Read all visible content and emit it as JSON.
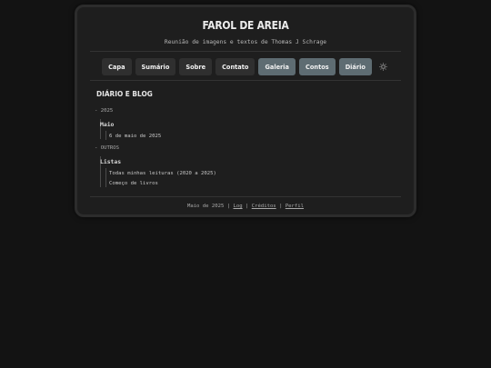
{
  "site": {
    "title": "FAROL DE AREIA",
    "subtitle": "Reunião de imagens e textos de Thomas J Schrage"
  },
  "nav": {
    "items": [
      {
        "label": "Capa",
        "accent": false
      },
      {
        "label": "Sumário",
        "accent": false
      },
      {
        "label": "Sobre",
        "accent": false
      },
      {
        "label": "Contato",
        "accent": false
      },
      {
        "label": "Galeria",
        "accent": true
      },
      {
        "label": "Contos",
        "accent": true
      },
      {
        "label": "Diário",
        "accent": true
      }
    ],
    "theme_icon": "sun-icon"
  },
  "main": {
    "section_title": "DIÁRIO E BLOG",
    "archive": [
      {
        "year": "2025",
        "groups": [
          {
            "label": "Maio",
            "entries": [
              "6 de maio de 2025"
            ]
          }
        ]
      },
      {
        "year": "OUTROS",
        "groups": [
          {
            "label": "Listas",
            "entries": [
              "Todas minhas leituras (2020 a 2025)",
              "Começo de livros"
            ]
          }
        ]
      }
    ]
  },
  "footer": {
    "date": "Maio de 2025",
    "sep1": "|",
    "link_log": "Log",
    "sep2": "|",
    "link_credits": "Créditos",
    "sep3": "|",
    "link_profile": "Perfil"
  },
  "colors": {
    "background": "#131313",
    "card": "#1e1e1e",
    "nav_button": "#2f2f2f",
    "nav_button_accent": "#5e6c72"
  }
}
